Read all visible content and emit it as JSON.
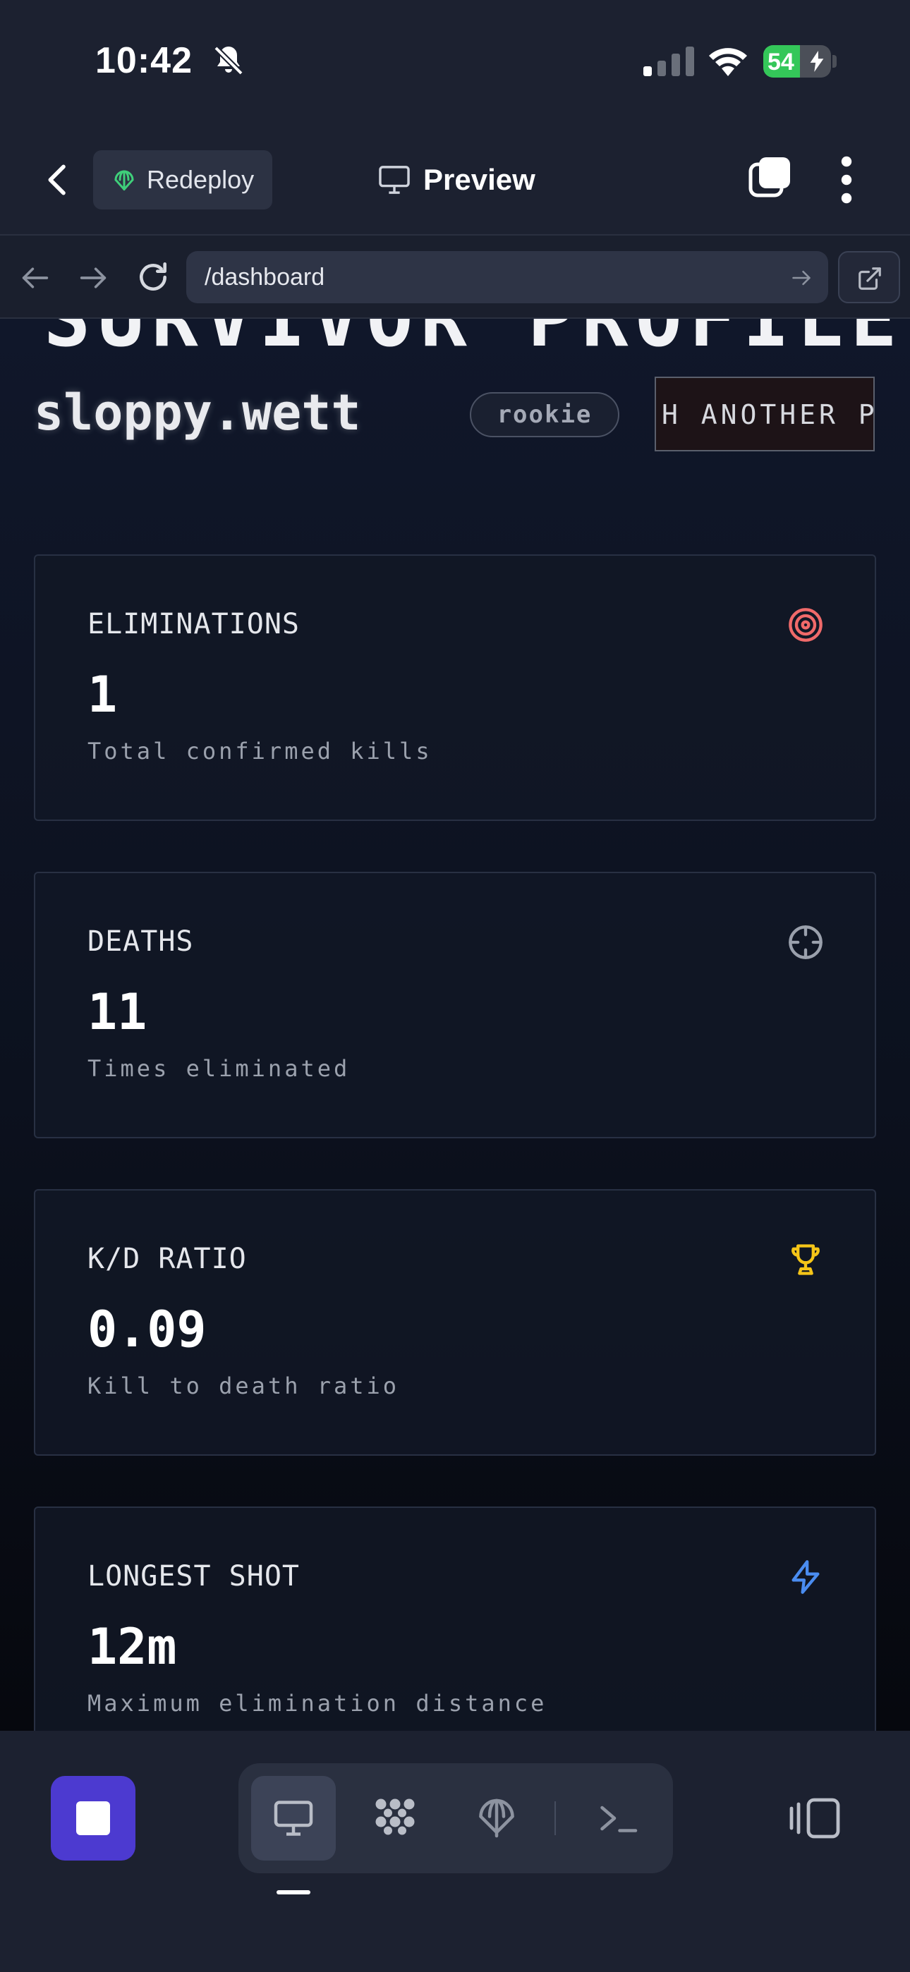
{
  "status_bar": {
    "time": "10:42",
    "battery_percent": "54",
    "battery_level": 0.54,
    "icons": [
      "bell-muted-icon",
      "signal-icon",
      "wifi-icon",
      "battery-charging-icon"
    ]
  },
  "app_bar": {
    "redeploy_label": "Redeploy",
    "title": "Preview",
    "icons": [
      "back-chevron-icon",
      "globe-icon",
      "monitor-icon",
      "tabs-icon",
      "more-vertical-icon"
    ]
  },
  "browser": {
    "url": "/dashboard",
    "icons": [
      "arrow-left-icon",
      "arrow-right-icon",
      "reload-icon",
      "arrow-right-icon",
      "external-link-icon"
    ]
  },
  "profile": {
    "heading": "SURVIVOR PROFILE",
    "username": "sloppy.wett",
    "rank": "rookie",
    "marquee": "H ANOTHER PI"
  },
  "stats": [
    {
      "label": "ELIMINATIONS",
      "value": "1",
      "description": "Total confirmed kills",
      "icon": "target-icon",
      "icon_color": "#f06a6a"
    },
    {
      "label": "DEATHS",
      "value": "11",
      "description": "Times eliminated",
      "icon": "crosshair-icon",
      "icon_color": "#9aa0ac"
    },
    {
      "label": "K/D RATIO",
      "value": "0.09",
      "description": "Kill to death ratio",
      "icon": "trophy-icon",
      "icon_color": "#f5c518"
    },
    {
      "label": "LONGEST SHOT",
      "value": "12m",
      "description": "Maximum elimination distance",
      "icon": "lightning-icon",
      "icon_color": "#4a8cf0"
    }
  ],
  "bottom_bar": {
    "icons": [
      "stop-icon",
      "monitor-icon",
      "grid-dots-icon",
      "globe-icon",
      "terminal-icon",
      "panel-toggle-icon"
    ],
    "accent": "#4c3ad0"
  }
}
